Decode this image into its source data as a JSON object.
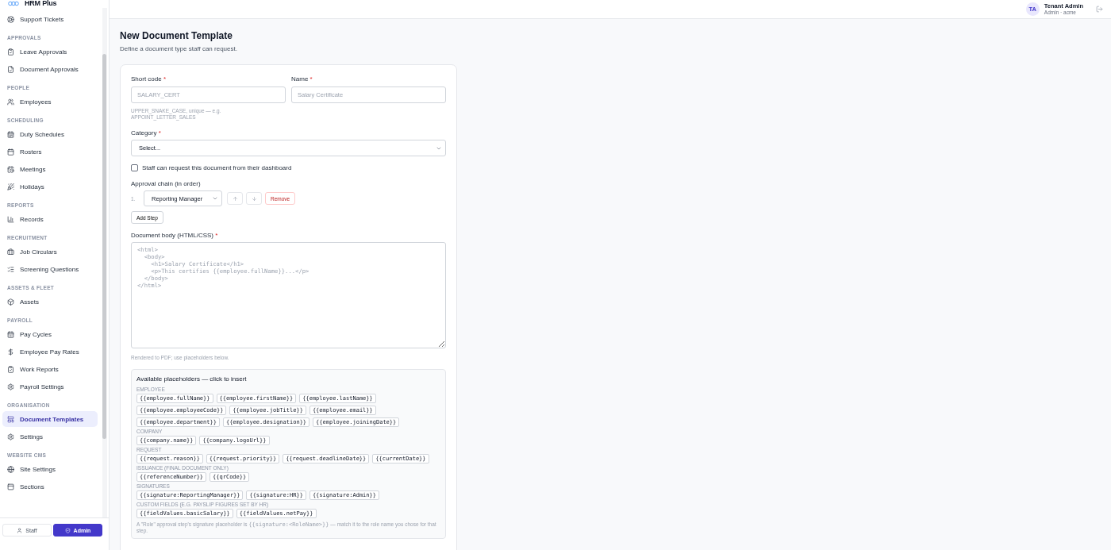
{
  "sidebar": {
    "brand": "HRM Plus",
    "sections": [
      {
        "items": [
          {
            "label": "Support Tickets",
            "selected": false
          }
        ]
      },
      {
        "label": "APPROVALS",
        "items": [
          {
            "label": "Leave Approvals",
            "selected": false
          },
          {
            "label": "Document Approvals",
            "selected": false
          }
        ]
      },
      {
        "label": "PEOPLE",
        "items": [
          {
            "label": "Employees",
            "selected": false
          }
        ]
      },
      {
        "label": "SCHEDULING",
        "items": [
          {
            "label": "Duty Schedules",
            "selected": false
          },
          {
            "label": "Rosters",
            "selected": false
          },
          {
            "label": "Meetings",
            "selected": false
          },
          {
            "label": "Holidays",
            "selected": false
          }
        ]
      },
      {
        "label": "REPORTS",
        "items": [
          {
            "label": "Records",
            "selected": false
          }
        ]
      },
      {
        "label": "RECRUITMENT",
        "items": [
          {
            "label": "Job Circulars",
            "selected": false
          },
          {
            "label": "Screening Questions",
            "selected": false
          }
        ]
      },
      {
        "label": "ASSETS & FLEET",
        "items": [
          {
            "label": "Assets",
            "selected": false
          }
        ]
      },
      {
        "label": "PAYROLL",
        "items": [
          {
            "label": "Pay Cycles",
            "selected": false
          },
          {
            "label": "Employee Pay Rates",
            "selected": false
          },
          {
            "label": "Work Reports",
            "selected": false
          },
          {
            "label": "Payroll Settings",
            "selected": false
          }
        ]
      },
      {
        "label": "ORGANISATION",
        "items": [
          {
            "label": "Document Templates",
            "selected": true
          },
          {
            "label": "Settings",
            "selected": false
          }
        ]
      },
      {
        "label": "WEBSITE CMS",
        "items": [
          {
            "label": "Site Settings",
            "selected": false
          },
          {
            "label": "Sections",
            "selected": false
          }
        ]
      }
    ],
    "modes": [
      {
        "label": "Staff",
        "selected": false
      },
      {
        "label": "Admin",
        "selected": true
      }
    ]
  },
  "user": {
    "initials": "TA",
    "name": "Tenant Admin",
    "detail": "Admin · acme"
  },
  "page": {
    "title": "New Document Template",
    "subtitle": "Define a document type staff can request."
  },
  "form": {
    "short_code": {
      "label": "Short code",
      "marker": "*",
      "placeholder": "SALARY_CERT",
      "hint": "UPPER_SNAKE_CASE, unique — e.g. APPOINT_LETTER_SALES"
    },
    "name": {
      "label": "Name",
      "marker": "*",
      "placeholder": "Salary Certificate"
    },
    "category": {
      "label": "Category",
      "marker": "*",
      "value": "Select..."
    },
    "staff_request": {
      "label": "Staff can request this document from their dashboard",
      "checked": false
    },
    "approval_chain": {
      "label": "Approval chain (in order)",
      "steps": [
        {
          "number": "1.",
          "role": "Reporting Manager",
          "remove": "Remove"
        }
      ],
      "add": "Add Step"
    },
    "body": {
      "label": "Document body (HTML/CSS)",
      "marker": "*",
      "placeholder": "<html>\n  <body>\n    <h1>Salary Certificate</h1>\n    <p>This certifies {{employee.fullName}}...</p>\n  </body>\n</html>",
      "hint": "Rendered to PDF; use placeholders below."
    },
    "placeholders": {
      "title": "Available placeholders — click to insert",
      "groups": [
        {
          "label": "EMPLOYEE",
          "chips": [
            "{{employee.fullName}}",
            "{{employee.firstName}}",
            "{{employee.lastName}}",
            "{{employee.employeeCode}}",
            "{{employee.jobTitle}}",
            "{{employee.email}}",
            "{{employee.department}}",
            "{{employee.designation}}",
            "{{employee.joiningDate}}"
          ]
        },
        {
          "label": "COMPANY",
          "chips": [
            "{{company.name}}",
            "{{company.logoUrl}}"
          ]
        },
        {
          "label": "REQUEST",
          "chips": [
            "{{request.reason}}",
            "{{request.priority}}",
            "{{request.deadlineDate}}",
            "{{currentDate}}"
          ]
        },
        {
          "label": "ISSUANCE (FINAL DOCUMENT ONLY)",
          "chips": [
            "{{referenceNumber}}",
            "{{qrCode}}"
          ]
        },
        {
          "label": "SIGNATURES",
          "chips": [
            "{{signature:ReportingManager}}",
            "{{signature:HR}}",
            "{{signature:Admin}}"
          ]
        },
        {
          "label": "CUSTOM FIELDS (E.G. PAYSLIP FIGURES SET BY HR)",
          "chips": [
            "{{fieldValues.basicSalary}}",
            "{{fieldValues.netPay}}"
          ]
        }
      ],
      "note": {
        "before": "A \"Role\" approval step's signature placeholder is ",
        "code": "{{signature:<RoleName>}}",
        "after": " — match it to the role name you chose for that step."
      }
    }
  }
}
